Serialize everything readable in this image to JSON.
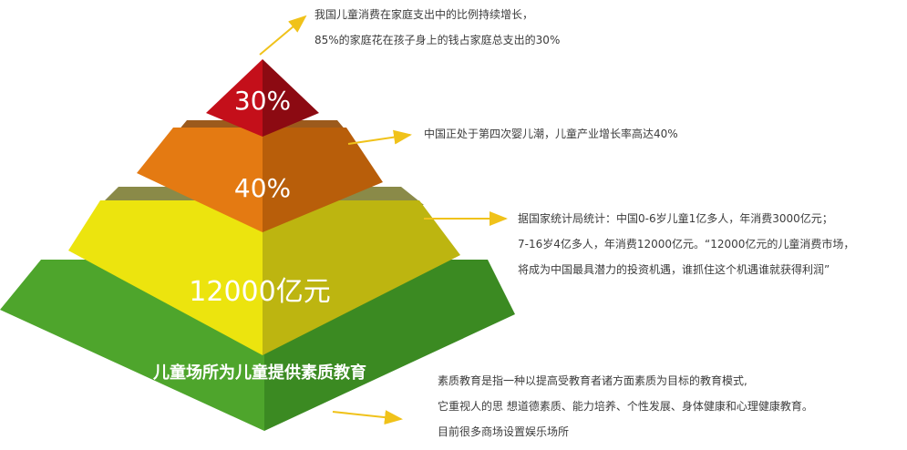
{
  "tiers": [
    {
      "label": "30%",
      "color_front": "#c40f1a",
      "color_side": "#8c0a12",
      "color_top": "#e8323a"
    },
    {
      "label": "40%",
      "color_front": "#e47a12",
      "color_side": "#b85e0a",
      "color_top": "#9c5a1c"
    },
    {
      "label": "12000亿元",
      "color_front": "#ece40e",
      "color_side": "#bdb510",
      "color_top": "#8a8a48"
    },
    {
      "label": "儿童场所为儿童提供素质教育",
      "color_front": "#4ea52c",
      "color_side": "#3b8a22",
      "color_top": "#2f6e1c"
    }
  ],
  "arrow_color": "#f0c21a",
  "notes": [
    {
      "lines": [
        "我国儿童消费在家庭支出中的比例持续增长，",
        "85%的家庭花在孩子身上的钱占家庭总支出的30%"
      ]
    },
    {
      "lines": [
        "中国正处于第四次婴儿潮，儿童产业增长率高达40%"
      ]
    },
    {
      "lines": [
        "据国家统计局统计：中国0-6岁儿童1亿多人，年消费3000亿元；",
        "7-16岁4亿多人，年消费12000亿元。“12000亿元的儿童消费市场，",
        "将成为中国最具潜力的投资机遇，谁抓住这个机遇谁就获得利润”"
      ]
    },
    {
      "lines": [
        "素质教育是指一种以提高受教育者诸方面素质为目标的教育模式,",
        "它重视人的思 想道德素质、能力培养、个性发展、身体健康和心理健康教育。",
        "目前很多商场设置娱乐场所"
      ]
    }
  ]
}
